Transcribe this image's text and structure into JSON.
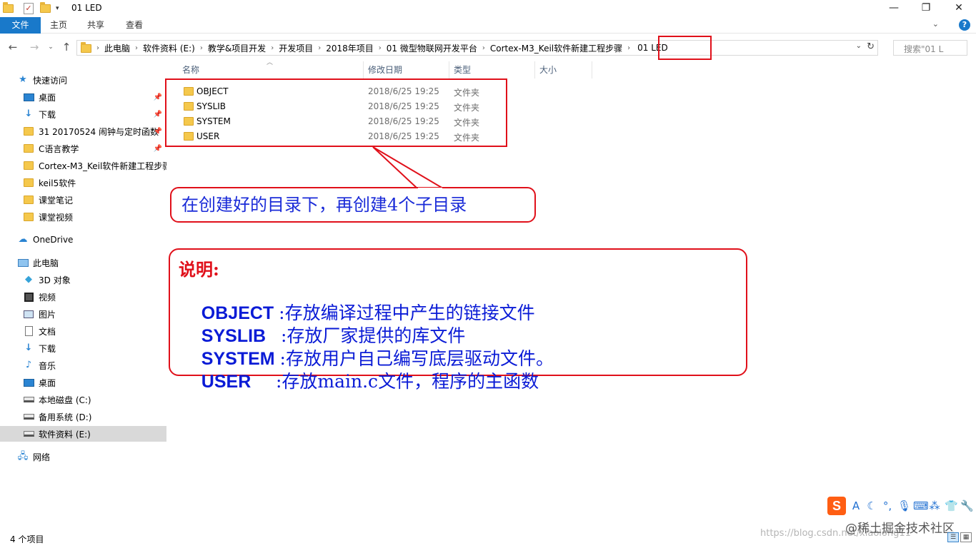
{
  "window": {
    "title": "01 LED",
    "controls": {
      "minimize": "—",
      "maximize": "❐",
      "close": "✕"
    }
  },
  "ribbon": {
    "tabs": [
      "文件",
      "主页",
      "共享",
      "查看"
    ]
  },
  "address_bar": {
    "breadcrumbs": [
      "此电脑",
      "软件资料 (E:)",
      "教学&项目开发",
      "开发项目",
      "2018年项目",
      "01 微型物联网开发平台",
      "Cortex-M3_Keil软件新建工程步骤",
      "01 LED"
    ],
    "search_placeholder": "搜索\"01 L"
  },
  "nav_pane": {
    "quick_access_label": "快速访问",
    "quick_access": [
      {
        "label": "桌面",
        "icon": "desktop-icon",
        "pinned": true
      },
      {
        "label": "下载",
        "icon": "download-icon",
        "pinned": true
      },
      {
        "label": "31 20170524  闹钟与定时函数",
        "icon": "folder-icon",
        "pinned": true
      },
      {
        "label": "C语言教学",
        "icon": "folder-icon",
        "pinned": true
      },
      {
        "label": "Cortex-M3_Keil软件新建工程步骤",
        "icon": "folder-icon",
        "pinned": false
      },
      {
        "label": "keil5软件",
        "icon": "folder-icon",
        "pinned": false
      },
      {
        "label": "课堂笔记",
        "icon": "folder-icon",
        "pinned": false
      },
      {
        "label": "课堂视频",
        "icon": "folder-icon",
        "pinned": false
      }
    ],
    "onedrive_label": "OneDrive",
    "this_pc_label": "此电脑",
    "this_pc": [
      {
        "label": "3D 对象",
        "icon": "cube-icon"
      },
      {
        "label": "视频",
        "icon": "video-icon"
      },
      {
        "label": "图片",
        "icon": "picture-icon"
      },
      {
        "label": "文档",
        "icon": "document-icon"
      },
      {
        "label": "下载",
        "icon": "download-icon"
      },
      {
        "label": "音乐",
        "icon": "music-icon"
      },
      {
        "label": "桌面",
        "icon": "desktop-icon"
      },
      {
        "label": "本地磁盘 (C:)",
        "icon": "drive-icon"
      },
      {
        "label": "备用系统 (D:)",
        "icon": "drive-icon"
      },
      {
        "label": "软件资料 (E:)",
        "icon": "drive-icon",
        "selected": true
      }
    ],
    "network_label": "网络"
  },
  "file_list": {
    "columns": [
      "名称",
      "修改日期",
      "类型",
      "大小"
    ],
    "rows": [
      {
        "name": "OBJECT",
        "modified": "2018/6/25 19:25",
        "type": "文件夹"
      },
      {
        "name": "SYSLIB",
        "modified": "2018/6/25 19:25",
        "type": "文件夹"
      },
      {
        "name": "SYSTEM",
        "modified": "2018/6/25 19:25",
        "type": "文件夹"
      },
      {
        "name": "USER",
        "modified": "2018/6/25 19:25",
        "type": "文件夹"
      }
    ]
  },
  "annotations": {
    "callout": "在创建好的目录下，再创建4个子目录",
    "note_title": "说明:",
    "note_lines": [
      {
        "key": "OBJECT ",
        "desc": ":存放编译过程中产生的链接文件"
      },
      {
        "key": "SYSLIB   ",
        "desc": ":存放厂家提供的库文件"
      },
      {
        "key": "SYSTEM ",
        "desc": ":存放用户自己编写底层驱动文件。"
      },
      {
        "key": "USER     ",
        "desc": ":存放main.c文件，程序的主函数"
      }
    ],
    "accent_color": "#e0101a",
    "text_color": "#0a1bd6"
  },
  "status_bar": {
    "item_count": "4 个项目"
  },
  "overlay": {
    "ime_logo": "S",
    "brand": "@稀土掘金技术社区",
    "watermark": "https://blog.csdn.net/xiaolong11"
  }
}
